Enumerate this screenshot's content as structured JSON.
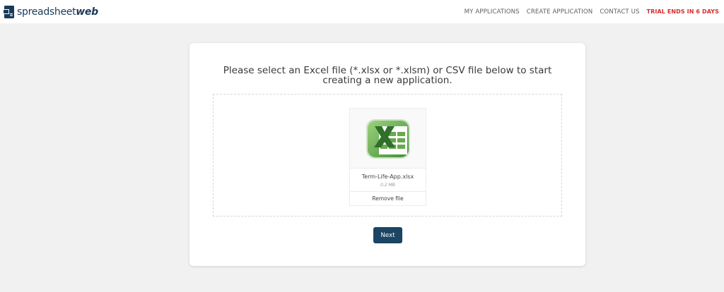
{
  "brand": {
    "name_part1": "spreadsheet",
    "name_part2": "web",
    "color": "#1b3a5a"
  },
  "nav": {
    "items": [
      {
        "label": "MY APPLICATIONS"
      },
      {
        "label": "CREATE APPLICATION"
      },
      {
        "label": "CONTACT US"
      }
    ],
    "trial_label": "TRIAL ENDS IN 6 DAYS",
    "trial_color": "#d42d2d"
  },
  "main": {
    "prompt": "Please select an Excel file (*.xlsx or *.xlsm) or CSV file below to start creating a new application.",
    "file": {
      "icon": "excel-file-icon",
      "name": "Term-Life-App.xlsx",
      "size": "0.2 MB",
      "remove_label": "Remove file"
    },
    "next_label": "Next",
    "button_color": "#1c4463"
  }
}
